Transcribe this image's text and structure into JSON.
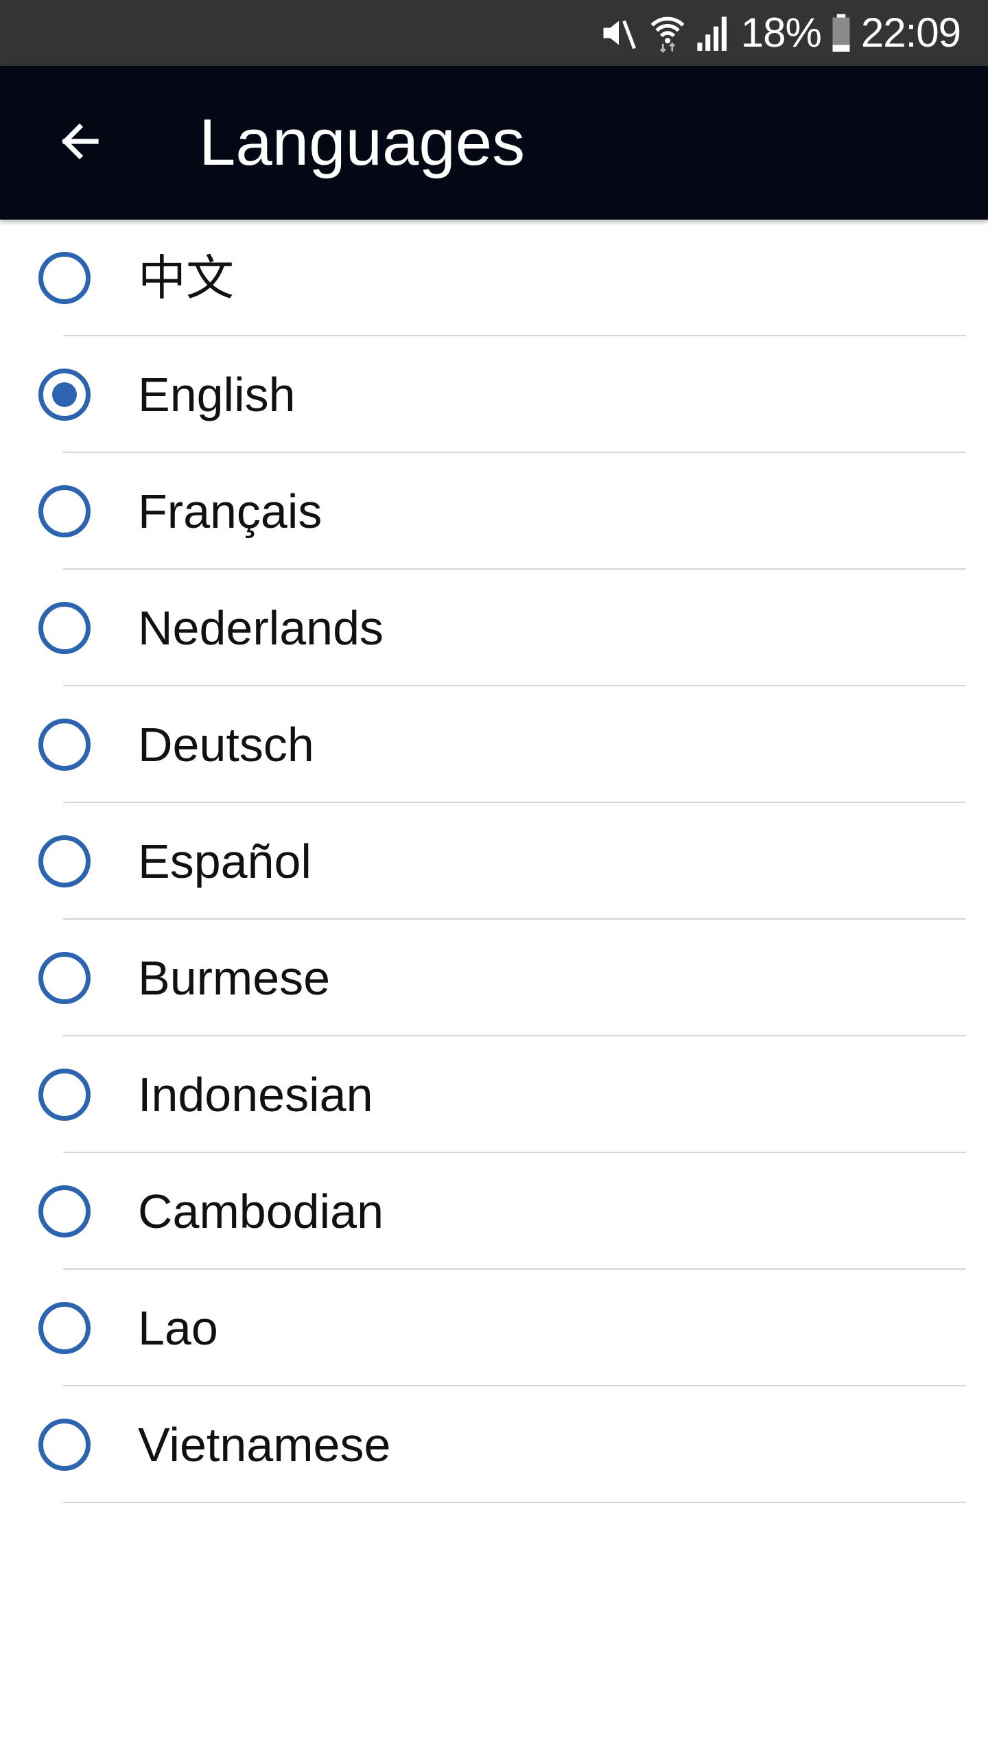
{
  "status_bar": {
    "icons": [
      "mute-icon",
      "wifi-icon",
      "signal-icon",
      "battery-icon"
    ],
    "battery": "18%",
    "time": "22:09"
  },
  "app_bar": {
    "back_icon": "arrow-left-icon",
    "title": "Languages"
  },
  "colors": {
    "status_bar": "#343434",
    "app_bar": "#040714",
    "radio_accent": "#2c64b0",
    "divider": "#d4d4d4"
  },
  "languages": [
    {
      "label": "中文",
      "selected": false
    },
    {
      "label": "English",
      "selected": true
    },
    {
      "label": "Français",
      "selected": false
    },
    {
      "label": "Nederlands",
      "selected": false
    },
    {
      "label": "Deutsch",
      "selected": false
    },
    {
      "label": "Español",
      "selected": false
    },
    {
      "label": "Burmese",
      "selected": false
    },
    {
      "label": "Indonesian",
      "selected": false
    },
    {
      "label": "Cambodian",
      "selected": false
    },
    {
      "label": "Lao",
      "selected": false
    },
    {
      "label": "Vietnamese",
      "selected": false
    }
  ]
}
